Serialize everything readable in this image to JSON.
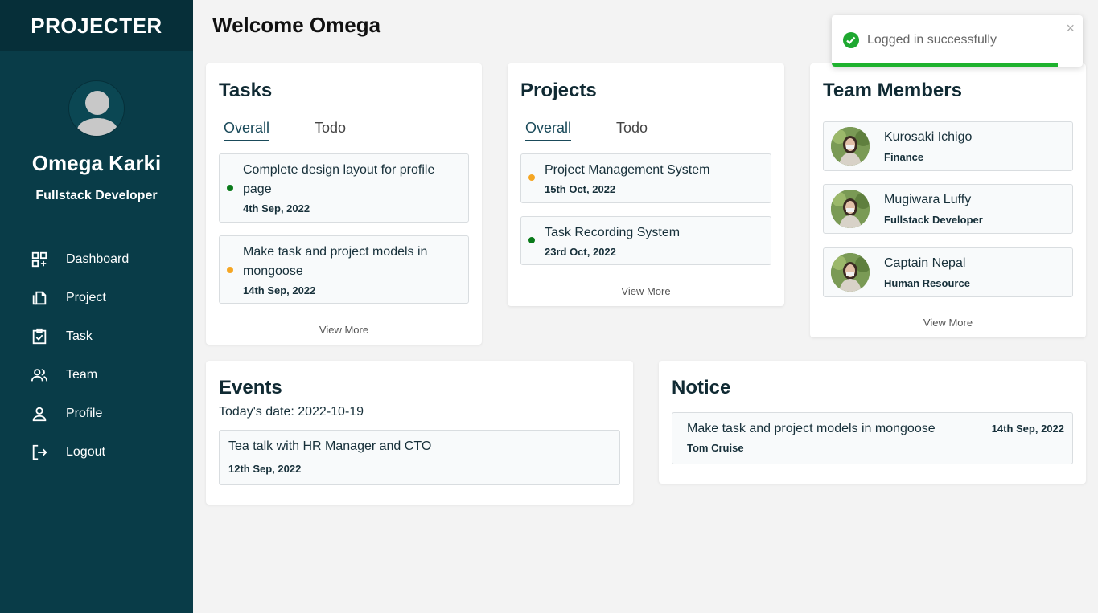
{
  "app": {
    "brand": "PROJECTER"
  },
  "user": {
    "name": "Omega Karki",
    "role": "Fullstack Developer"
  },
  "nav": [
    {
      "label": "Dashboard",
      "icon": "dashboard-icon"
    },
    {
      "label": "Project",
      "icon": "copy-icon"
    },
    {
      "label": "Task",
      "icon": "clipboard-check-icon"
    },
    {
      "label": "Team",
      "icon": "users-icon"
    },
    {
      "label": "Profile",
      "icon": "user-icon"
    },
    {
      "label": "Logout",
      "icon": "logout-icon"
    }
  ],
  "header": {
    "welcome": "Welcome Omega"
  },
  "tasks": {
    "title": "Tasks",
    "tabs": [
      "Overall",
      "Todo"
    ],
    "items": [
      {
        "text": "Complete design layout for profile page",
        "date": "4th Sep, 2022",
        "status_color": "#0a7a1a"
      },
      {
        "text": "Make task and project models in mongoose",
        "date": "14th Sep, 2022",
        "status_color": "#f5a623"
      }
    ],
    "view_more": "View More"
  },
  "projects": {
    "title": "Projects",
    "tabs": [
      "Overall",
      "Todo"
    ],
    "items": [
      {
        "text": "Project Management System",
        "date": "15th Oct, 2022",
        "status_color": "#f5a623"
      },
      {
        "text": "Task Recording System",
        "date": "23rd Oct, 2022",
        "status_color": "#0a7a1a"
      }
    ],
    "view_more": "View More"
  },
  "team": {
    "title": "Team Members",
    "members": [
      {
        "name": "Kurosaki Ichigo",
        "role": "Finance"
      },
      {
        "name": "Mugiwara Luffy",
        "role": "Fullstack Developer"
      },
      {
        "name": "Captain Nepal",
        "role": "Human Resource"
      }
    ],
    "view_more": "View More"
  },
  "events": {
    "title": "Events",
    "today": "Today's date: 2022-10-19",
    "items": [
      {
        "text": "Tea talk with HR Manager and CTO",
        "date": "12th Sep, 2022"
      }
    ]
  },
  "notice": {
    "title": "Notice",
    "items": [
      {
        "text": "Make task and project models in mongoose",
        "author": "Tom Cruise",
        "date": "14th Sep, 2022"
      }
    ]
  },
  "toast": {
    "message": "Logged in successfully",
    "close": "×",
    "progress": 0.9
  },
  "colors": {
    "sidebar": "#093c48",
    "brand_bar": "#062f39",
    "success": "#1eb22e"
  }
}
